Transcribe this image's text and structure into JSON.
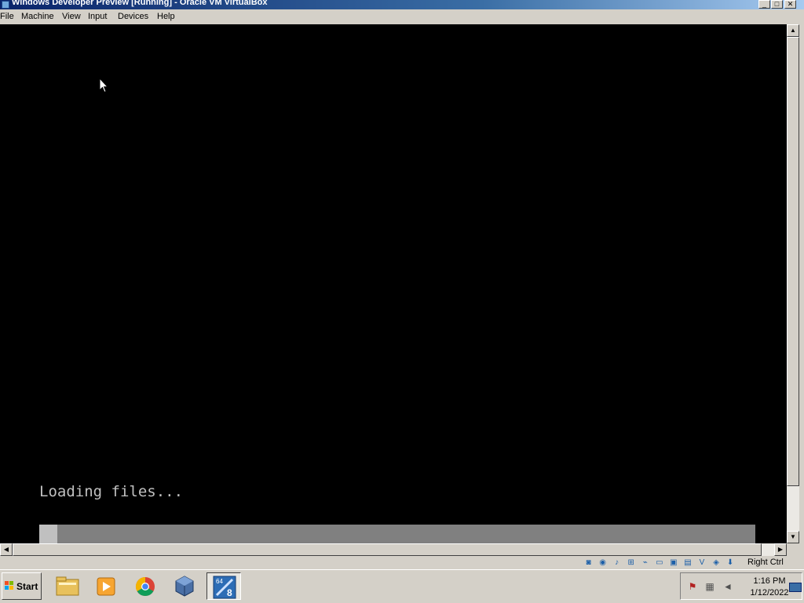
{
  "window": {
    "title": "Windows Developer Preview [Running] - Oracle VM VirtualBox",
    "controls": {
      "minimize": "_",
      "maximize": "□",
      "close": "✕"
    }
  },
  "menu": [
    "File",
    "Machine",
    "View",
    "Input",
    "Devices",
    "Help"
  ],
  "vm": {
    "loading_text": "Loading files...",
    "progress": 0.025,
    "colors": {
      "screen": "#000000",
      "text": "#c0c0c0",
      "bar_track": "#808080",
      "bar_fill": "#c0c0c0"
    }
  },
  "statusbar": {
    "icons": [
      "hard-disk-icon",
      "optical-drive-icon",
      "audio-icon",
      "network-icon",
      "usb-icon",
      "shared-folders-icon",
      "display-icon",
      "video-capture-icon",
      "virtualization-icon",
      "mouse-integration-icon",
      "keyboard-icon"
    ],
    "host_key": "Right Ctrl"
  },
  "taskbar": {
    "start_label": "Start",
    "apps": [
      "file-explorer-icon",
      "media-player-icon",
      "chrome-icon",
      "virtualbox-icon",
      "windows8-vm-icon"
    ],
    "tray_icons": [
      "action-center-icon",
      "network-icon",
      "volume-icon"
    ],
    "clock": {
      "time": "1:16 PM",
      "date": "1/12/2022"
    }
  },
  "scroll": {
    "up": "▲",
    "down": "▼",
    "left": "◀",
    "right": "▶"
  },
  "badges": {
    "arch": "64",
    "version": "8"
  }
}
